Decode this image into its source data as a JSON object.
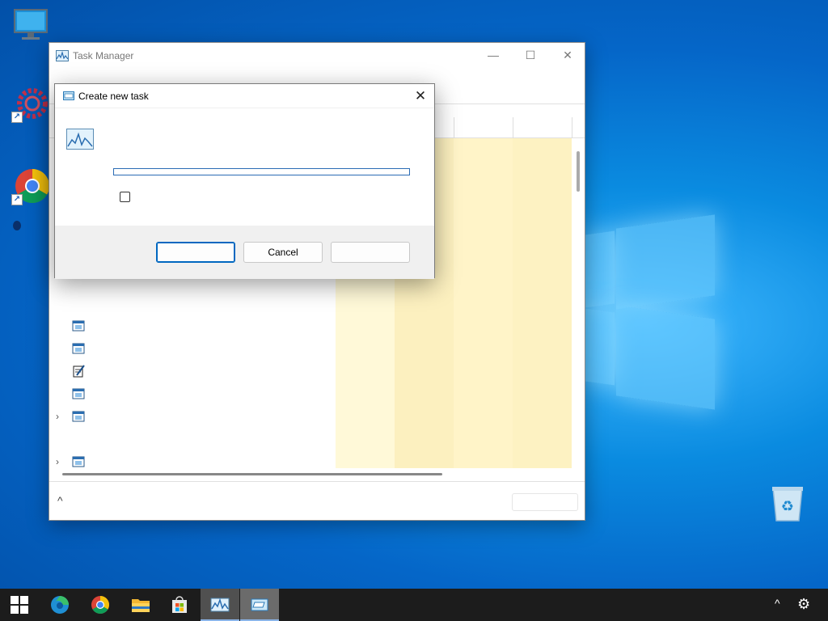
{
  "desktop": {
    "icons": [
      {
        "name": "this-pc-icon"
      },
      {
        "name": "settings-shortcut-icon"
      },
      {
        "name": "chrome-shortcut-icon"
      },
      {
        "name": "recycle-bin-icon"
      }
    ]
  },
  "task_manager": {
    "title": "Task Manager",
    "minimize_glyph": "—",
    "maximize_glyph": "☐",
    "close_glyph": "✕",
    "fewer_details_glyph": "^",
    "rows": [
      {
        "icon": "app-window-icon",
        "expandable": false
      },
      {
        "icon": "app-window-icon",
        "expandable": false
      },
      {
        "icon": "notepad-icon",
        "expandable": false
      },
      {
        "icon": "app-window-icon",
        "expandable": false
      },
      {
        "icon": "app-window-icon",
        "expandable": true
      },
      {
        "icon": "blank",
        "expandable": false
      },
      {
        "icon": "app-window-icon",
        "expandable": true
      },
      {
        "icon": "app-window-icon",
        "expandable": true
      },
      {
        "icon": "user-service-icon",
        "expandable": true
      }
    ],
    "column_colors": [
      "#fff9d8",
      "#fcf0bf",
      "#fff4c8",
      "#fdf2c2"
    ]
  },
  "dialog": {
    "title": "Create new task",
    "close_glyph": "✕",
    "open_input_value": "",
    "ok_label": "",
    "cancel_label": "Cancel",
    "browse_label": ""
  },
  "taskbar": {
    "items": [
      {
        "name": "start-button-icon"
      },
      {
        "name": "edge-icon"
      },
      {
        "name": "chrome-icon"
      },
      {
        "name": "file-explorer-icon"
      },
      {
        "name": "store-icon"
      },
      {
        "name": "task-manager-taskbar-icon"
      },
      {
        "name": "create-task-taskbar-icon"
      }
    ],
    "tray_chevron": "^",
    "tray_gear": "⚙"
  },
  "colors": {
    "accent": "#0067c0",
    "desktop_blue": "#0a8be0",
    "taskbar": "#1c1c1c"
  }
}
